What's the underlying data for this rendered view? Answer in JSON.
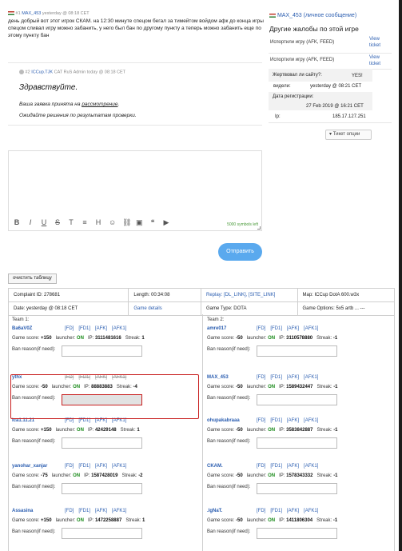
{
  "comments": [
    {
      "number": "#1",
      "author": "MAX_453",
      "time": "yesterday @ 08:18 CET",
      "text": "день добрый вот этот игрок СКАМ. на 12:30 минуте спецом бегал за тимейтом войдом афк до конца игры спецом сливал игру можно забанить, у него был бан по другому пункту а теперь можно забанить еще по этому пункту бан"
    },
    {
      "number": "#2",
      "author": "ICCup.TJK",
      "role": "CAT RuS Admin",
      "time": "today @ 08:18 CET",
      "greeting": "Здравствуйте.",
      "line1_prefix": "Ваша заявка принята на ",
      "line1_link": "рассмотрение",
      "line1_suffix": ".",
      "line2": "Ожидайте решения по результатам проверки."
    }
  ],
  "right": {
    "user": "MAX_453 (личное сообщение)",
    "other_title": "Другие жалобы по этой игре",
    "complaints": [
      {
        "label": "Испортили игру (AFK, FEED)",
        "link": "View ticket"
      },
      {
        "label": "Испортили игру (AFK, FEED)",
        "link": "View ticket"
      }
    ],
    "victim_label": "Жертвовал ли сайту?:",
    "victim_value": "YES!",
    "seen_label": "видели:",
    "seen_value": "yesterday @ 08:21 CET",
    "reg_label": "Дата регистрации:",
    "reg_value": "27 Feb 2019 @ 16:21 CET",
    "ip_label": "Ip:",
    "ip_value": "185.17.127.251",
    "options_label": "Тикет опции"
  },
  "editor": {
    "counter": "5000 symbols left",
    "send": "Отправить",
    "toolbar": [
      "B",
      "I",
      "U",
      "S",
      "T",
      "≡",
      "H",
      "☺",
      "⛓",
      "▣",
      "❝",
      "▶"
    ]
  },
  "clear_button": "очистить таблицу",
  "info": {
    "row1": [
      "Complaint ID: 278681",
      "Length: 00:34:08",
      "Replay: [DL_LINK], [SITE_LINK]",
      "Map: ICCup DotA 600.w3x"
    ],
    "row2": [
      "Date: yesterday @ 08:18 CET",
      "Game details",
      "Game Type: DOTA",
      "Game Options: 5x5 artb ... ---"
    ]
  },
  "teams": {
    "team1_label": "Team 1:",
    "team2_label": "Team 2:",
    "ban_label": "Ban reason(if need):",
    "links": [
      "[FD]",
      "[FD1]",
      "[AFK]",
      "[AFK1]"
    ],
    "team1": [
      {
        "name": "Ba6aV0Z",
        "score": "+150",
        "launcher": "ON",
        "ip": "3111481616",
        "streak": "1"
      },
      {
        "name": "ythx",
        "score": "-50",
        "launcher": "ON",
        "ip": "88883883",
        "streak": "-4"
      },
      {
        "name": "lca1.11.21",
        "score": "+150",
        "launcher": "ON",
        "ip": "42429148",
        "streak": "1"
      },
      {
        "name": "yanohar_xanjar",
        "score": "-75",
        "launcher": "ON",
        "ip": "1587428019",
        "streak": "-2"
      },
      {
        "name": "Assasina",
        "score": "+150",
        "launcher": "ON",
        "ip": "1472258887",
        "streak": "1"
      }
    ],
    "team2": [
      {
        "name": "amre017",
        "score": "-50",
        "launcher": "ON",
        "ip": "3110578880",
        "streak": "-1"
      },
      {
        "name": "MAX_453",
        "score": "-50",
        "launcher": "ON",
        "ip": "1589432447",
        "streak": "-1"
      },
      {
        "name": "ohupakabraaa",
        "score": "-50",
        "launcher": "ON",
        "ip": "3583842887",
        "streak": "-1"
      },
      {
        "name": "CKAM.",
        "score": "-50",
        "launcher": "ON",
        "ip": "1578343332",
        "streak": "-1"
      },
      {
        "name": ".lgNaT.",
        "score": "-50",
        "launcher": "ON",
        "ip": "1411806304",
        "streak": "-1"
      }
    ],
    "labels": {
      "score": "Game score:",
      "launcher": "launcher:",
      "ip": "IP:",
      "streak": "Streak:"
    }
  }
}
